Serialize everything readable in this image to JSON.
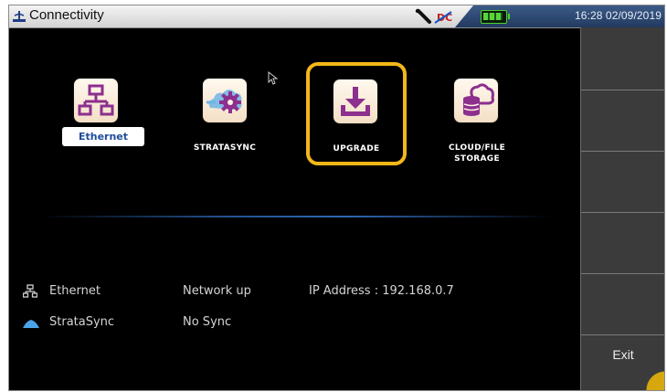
{
  "window": {
    "title": "Connectivity"
  },
  "status": {
    "datetime": "16:28 02/09/2019",
    "battery_level": 1.0
  },
  "apps": [
    {
      "label": "Ethernet",
      "icon": "network-icon"
    },
    {
      "label": "STRATASYNC",
      "icon": "cloud-gear-icon"
    },
    {
      "label": "UPGRADE",
      "icon": "download-icon"
    },
    {
      "label_line1": "CLOUD/FILE",
      "label_line2": "STORAGE",
      "icon": "cloud-database-icon"
    }
  ],
  "status_list": [
    {
      "name": "Ethernet",
      "state": "Network up",
      "detail": "IP Address : 192.168.0.7",
      "icon": "network-icon"
    },
    {
      "name": "StrataSync",
      "state": "No Sync",
      "icon": "cloud-icon"
    }
  ],
  "softkeys": {
    "exit_label": "Exit"
  },
  "colors": {
    "highlight": "#f4b718",
    "icon_purple": "#8c2f8e",
    "background": "#000000"
  }
}
